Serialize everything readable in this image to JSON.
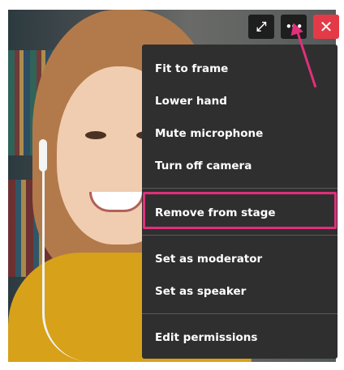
{
  "controls": {
    "expand_icon": "⤢",
    "more_icon": "•••",
    "close_icon": "✕"
  },
  "menu": {
    "items": [
      "Fit to frame",
      "Lower hand",
      "Mute microphone",
      "Turn off camera",
      "Remove from stage",
      "Set as moderator",
      "Set as speaker",
      "Edit permissions"
    ]
  },
  "colors": {
    "accent_highlight": "#e0307b",
    "close_button": "#e43a48",
    "menu_background": "#2f2f2f"
  }
}
